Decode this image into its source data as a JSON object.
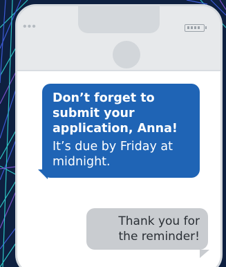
{
  "colors": {
    "background": "#0e2040",
    "accent_lines": [
      "#2ec4c4",
      "#3d5bd6",
      "#7a4fc9"
    ],
    "incoming_bubble": "#1f64b5",
    "outgoing_bubble": "#c9ccd0"
  },
  "phone": {
    "status_dots": "•••",
    "battery_icon": "battery-icon"
  },
  "messages": {
    "incoming": {
      "bold_text": "Don’t forget to submit your application, Anna!",
      "regular_text": "It’s due by Friday at midnight."
    },
    "outgoing": {
      "text": "Thank you for the reminder!"
    }
  }
}
